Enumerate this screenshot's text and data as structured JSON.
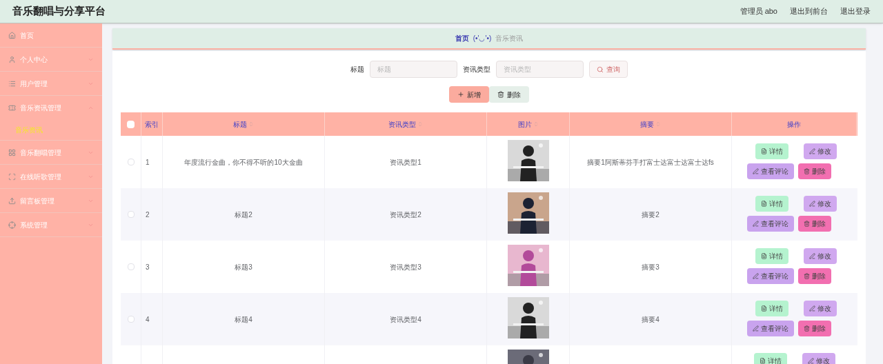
{
  "header": {
    "title": "音乐翻唱与分享平台",
    "links": [
      "管理员 abo",
      "退出到前台",
      "退出登录"
    ]
  },
  "sidebar": {
    "items": [
      {
        "label": "首页",
        "expandable": false,
        "expanded": false
      },
      {
        "label": "个人中心",
        "expandable": true,
        "expanded": false
      },
      {
        "label": "用户管理",
        "expandable": true,
        "expanded": false
      },
      {
        "label": "音乐资讯管理",
        "expandable": true,
        "expanded": true,
        "children": [
          {
            "label": "音乐资讯",
            "selected": true
          }
        ]
      },
      {
        "label": "音乐翻唱管理",
        "expandable": true,
        "expanded": false
      },
      {
        "label": "在线听歌管理",
        "expandable": true,
        "expanded": false
      },
      {
        "label": "留言板管理",
        "expandable": true,
        "expanded": false
      },
      {
        "label": "系统管理",
        "expandable": true,
        "expanded": false
      }
    ]
  },
  "breadcrumb": {
    "home": "首页",
    "separator": "(•'◡'•)",
    "current": "音乐资讯"
  },
  "search": {
    "fields": [
      {
        "label": "标题",
        "placeholder": "标题"
      },
      {
        "label": "资讯类型",
        "placeholder": "资讯类型"
      }
    ],
    "button": "查询"
  },
  "toolbar": [
    {
      "label": "新增",
      "kind": "add"
    },
    {
      "label": "删除",
      "kind": "delete"
    }
  ],
  "table": {
    "all_checked": false,
    "columns": [
      {
        "label": "索引",
        "sortable": false
      },
      {
        "label": "标题",
        "sortable": true
      },
      {
        "label": "资讯类型",
        "sortable": true
      },
      {
        "label": "图片",
        "sortable": true
      },
      {
        "label": "摘要",
        "sortable": true
      },
      {
        "label": "操作",
        "sortable": false
      }
    ],
    "rows": [
      {
        "checked": false,
        "index": "1",
        "title": "年度流行金曲，你不得不听的10大金曲",
        "type": "资讯类型1",
        "summary": "摘要1阿斯蒂芬手打富士达富士达富士达fs",
        "actions": [
          {
            "label": "详情",
            "kind": "detail"
          },
          {
            "label": "修改",
            "kind": "edit"
          },
          {
            "label": "查看评论",
            "kind": "comments"
          },
          {
            "label": "删除",
            "kind": "delete"
          }
        ]
      },
      {
        "checked": false,
        "index": "2",
        "title": "标题2",
        "type": "资讯类型2",
        "summary": "摘要2",
        "actions": [
          {
            "label": "详情",
            "kind": "detail"
          },
          {
            "label": "修改",
            "kind": "edit"
          },
          {
            "label": "查看评论",
            "kind": "comments"
          },
          {
            "label": "删除",
            "kind": "delete"
          }
        ]
      },
      {
        "checked": false,
        "index": "3",
        "title": "标题3",
        "type": "资讯类型3",
        "summary": "摘要3",
        "actions": [
          {
            "label": "详情",
            "kind": "detail"
          },
          {
            "label": "修改",
            "kind": "edit"
          },
          {
            "label": "查看评论",
            "kind": "comments"
          },
          {
            "label": "删除",
            "kind": "delete"
          }
        ]
      },
      {
        "checked": false,
        "index": "4",
        "title": "标题4",
        "type": "资讯类型4",
        "summary": "摘要4",
        "actions": [
          {
            "label": "详情",
            "kind": "detail"
          },
          {
            "label": "修改",
            "kind": "edit"
          },
          {
            "label": "查看评论",
            "kind": "comments"
          },
          {
            "label": "删除",
            "kind": "delete"
          }
        ]
      },
      {
        "actions": [
          {
            "label": "详情",
            "kind": "detail"
          },
          {
            "label": "修改",
            "kind": "edit"
          }
        ]
      }
    ]
  }
}
